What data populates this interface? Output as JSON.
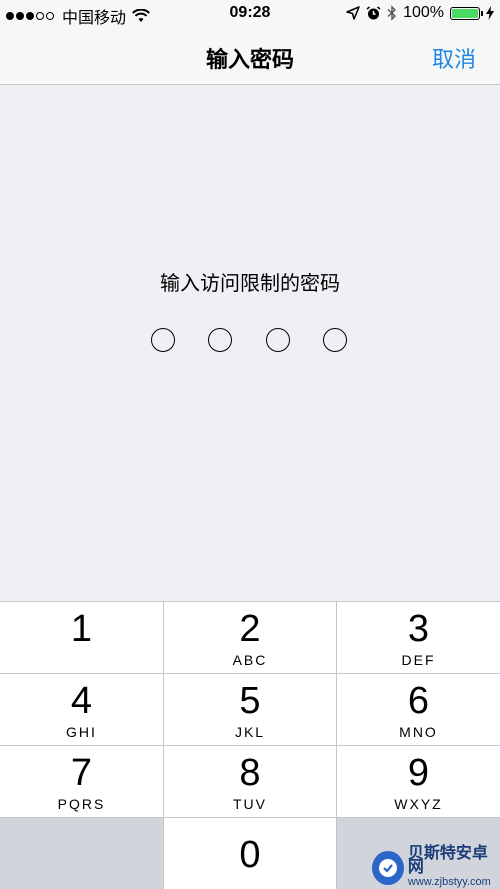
{
  "status_bar": {
    "signal_dots": [
      "full",
      "full",
      "full",
      "empty",
      "empty"
    ],
    "carrier": "中国移动",
    "time": "09:28",
    "battery_percent": "100%",
    "battery_level": 1.0,
    "icons": [
      "location-arrow-icon",
      "alarm-icon",
      "bluetooth-icon",
      "charging-bolt-icon"
    ]
  },
  "nav": {
    "title": "输入密码",
    "cancel": "取消"
  },
  "prompt": "输入访问限制的密码",
  "pin": {
    "length": 4,
    "filled": 0
  },
  "keypad": {
    "keys": [
      {
        "num": "1",
        "letters": ""
      },
      {
        "num": "2",
        "letters": "ABC"
      },
      {
        "num": "3",
        "letters": "DEF"
      },
      {
        "num": "4",
        "letters": "GHI"
      },
      {
        "num": "5",
        "letters": "JKL"
      },
      {
        "num": "6",
        "letters": "MNO"
      },
      {
        "num": "7",
        "letters": "PQRS"
      },
      {
        "num": "8",
        "letters": "TUV"
      },
      {
        "num": "9",
        "letters": "WXYZ"
      },
      {
        "num": "0",
        "letters": ""
      }
    ]
  },
  "watermark": {
    "name": "贝斯特安卓网",
    "url": "www.zjbstyy.com"
  },
  "colors": {
    "accent": "#1f86e6",
    "background": "#efeff4",
    "battery": "#4cd964"
  }
}
